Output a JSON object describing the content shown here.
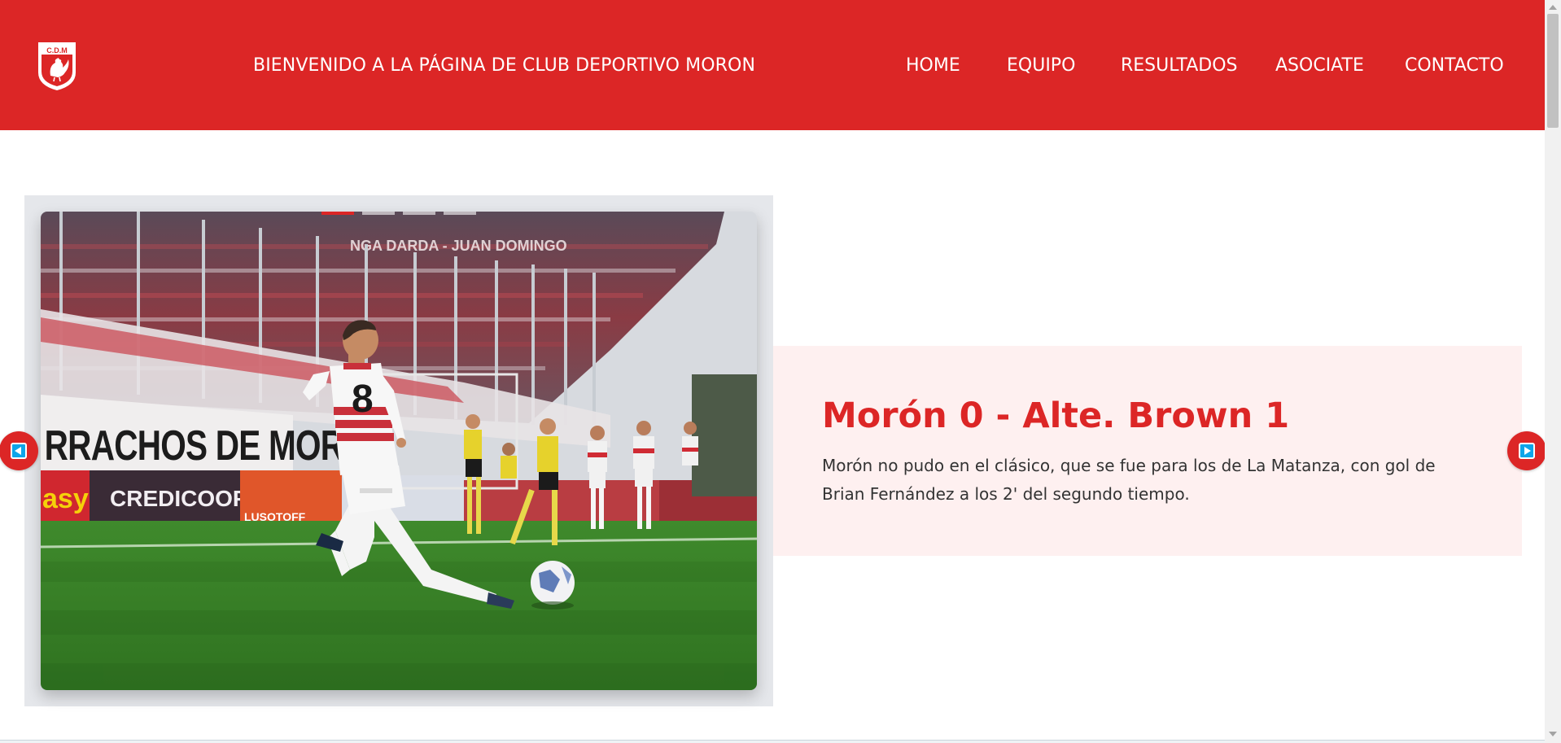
{
  "header": {
    "logo_text": "C.D.M",
    "welcome": "BIENVENIDO A LA PÁGINA DE CLUB DEPORTIVO MORON",
    "nav": [
      "HOME",
      "EQUIPO",
      "RESULTADOS",
      "ASOCIATE",
      "CONTACTO"
    ]
  },
  "carousel": {
    "slide_count": 4,
    "active_index": 0,
    "title": "Morón 0 - Alte. Brown 1",
    "body": "Morón no pudo en el clásico, que se fue para los de La Matanza, con gol de Brian Fernández a los 2' del segundo tiempo.",
    "photo": {
      "shirt_number": "8",
      "banner_fans": "RRACHOS DE MORON",
      "banner_stadium": "NGA  DARDA - JUAN DOMINGO",
      "ad_credicoop": "CREDICOOP",
      "ad_easy": "asy",
      "ad_lusotoff": "LUSOTOFF"
    }
  },
  "colors": {
    "brand": "#dc2626",
    "caption_bg": "#fef0f0",
    "frame_bg": "#e5e7eb",
    "arrow_glyph": "#0ea5e9"
  },
  "icons": {
    "prev": "left-arrow-icon",
    "next": "right-arrow-icon",
    "logo": "rooster-crest-icon"
  }
}
